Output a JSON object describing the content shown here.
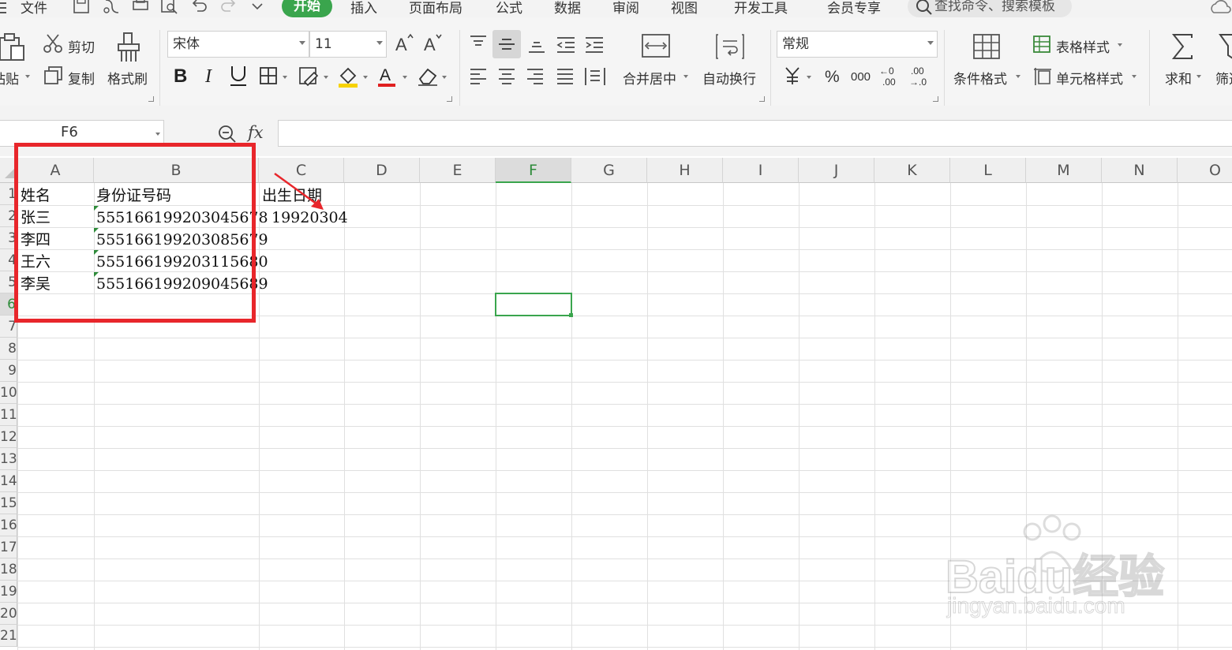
{
  "menubar": {
    "file": "文件",
    "tabs": [
      "开始",
      "插入",
      "页面布局",
      "公式",
      "数据",
      "审阅",
      "视图",
      "开发工具",
      "会员专享"
    ],
    "search_placeholder": "查找命令、搜索模板"
  },
  "ribbon": {
    "paste": "粘贴",
    "cut": "剪切",
    "copy": "复制",
    "format_painter": "格式刷",
    "font_name": "宋体",
    "font_size": "11",
    "merge_center": "合并居中",
    "wrap_text": "自动换行",
    "number_format": "常规",
    "conditional_format": "条件格式",
    "table_style": "表格样式",
    "cell_style": "单元格样式",
    "sum": "求和",
    "filter": "筛选"
  },
  "formula_bar": {
    "name_box": "F6",
    "fx": "fx",
    "content": ""
  },
  "sheet": {
    "columns": [
      "A",
      "B",
      "C",
      "D",
      "E",
      "F",
      "G",
      "H",
      "I",
      "J",
      "K",
      "L",
      "M",
      "N",
      "O"
    ],
    "active_column": "F",
    "rows": [
      "1",
      "2",
      "3",
      "4",
      "5",
      "6",
      "7",
      "8",
      "9",
      "10",
      "11",
      "12",
      "13",
      "14",
      "15",
      "16",
      "17",
      "18",
      "19",
      "20",
      "21"
    ],
    "active_row": "6",
    "cells": {
      "A1": "姓名",
      "B1": "身份证号码",
      "C1": "出生日期",
      "A2": "张三",
      "B2": "555166199203045678",
      "C2": "19920304",
      "A3": "李四",
      "B3": "555166199203085679",
      "A4": "王六",
      "B4": "555166199203115680",
      "A5": "李吴",
      "B5": "555166199209045689"
    }
  },
  "watermark": {
    "brand": "Baidu经验",
    "url": "jingyan.baidu.com"
  },
  "colors": {
    "accent": "#3aa54d",
    "highlight": "#e8262b"
  }
}
